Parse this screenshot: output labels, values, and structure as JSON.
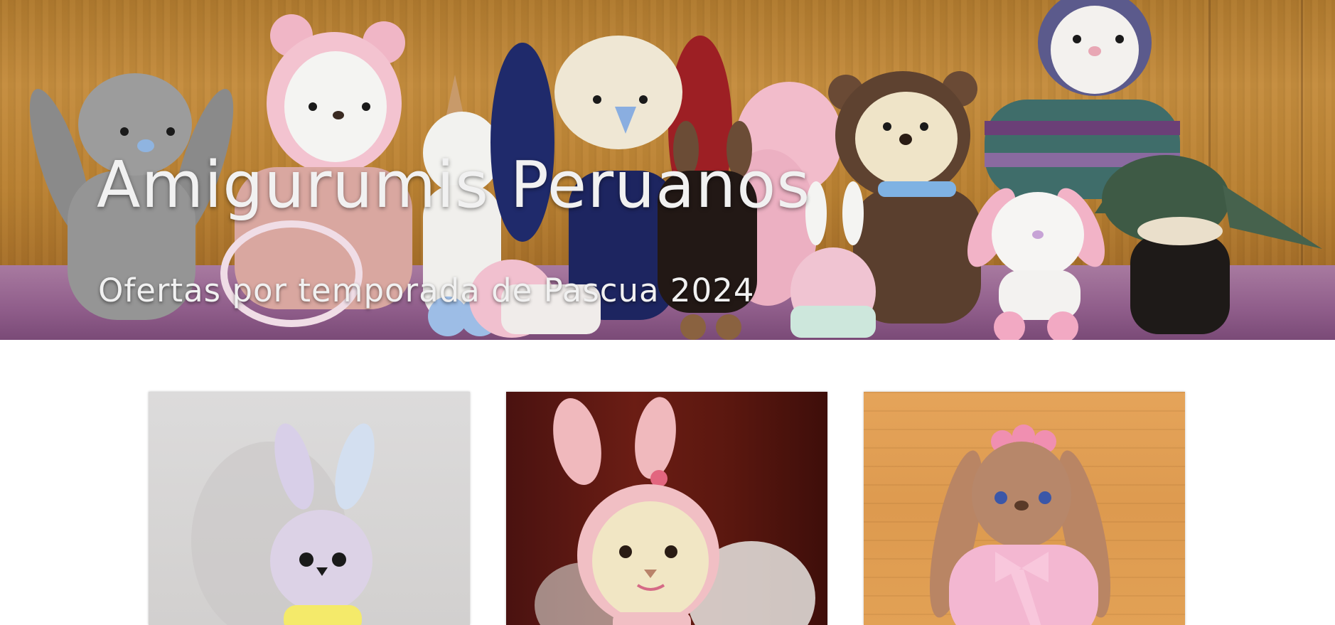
{
  "hero": {
    "title": "Amigurumis Peruanos",
    "subtitle": "Ofertas por temporada de Pascua 2024",
    "image_description_icon": "amigurumi-group-photo"
  },
  "products": [
    {
      "image_icon": "rainbow-bunny-amigurumi-photo"
    },
    {
      "image_icon": "pink-bunny-amigurumi-photo"
    },
    {
      "image_icon": "brown-bunny-amigurumi-photo"
    }
  ],
  "colors": {
    "title_text": "#f1f1f1",
    "page_background": "#ffffff"
  }
}
